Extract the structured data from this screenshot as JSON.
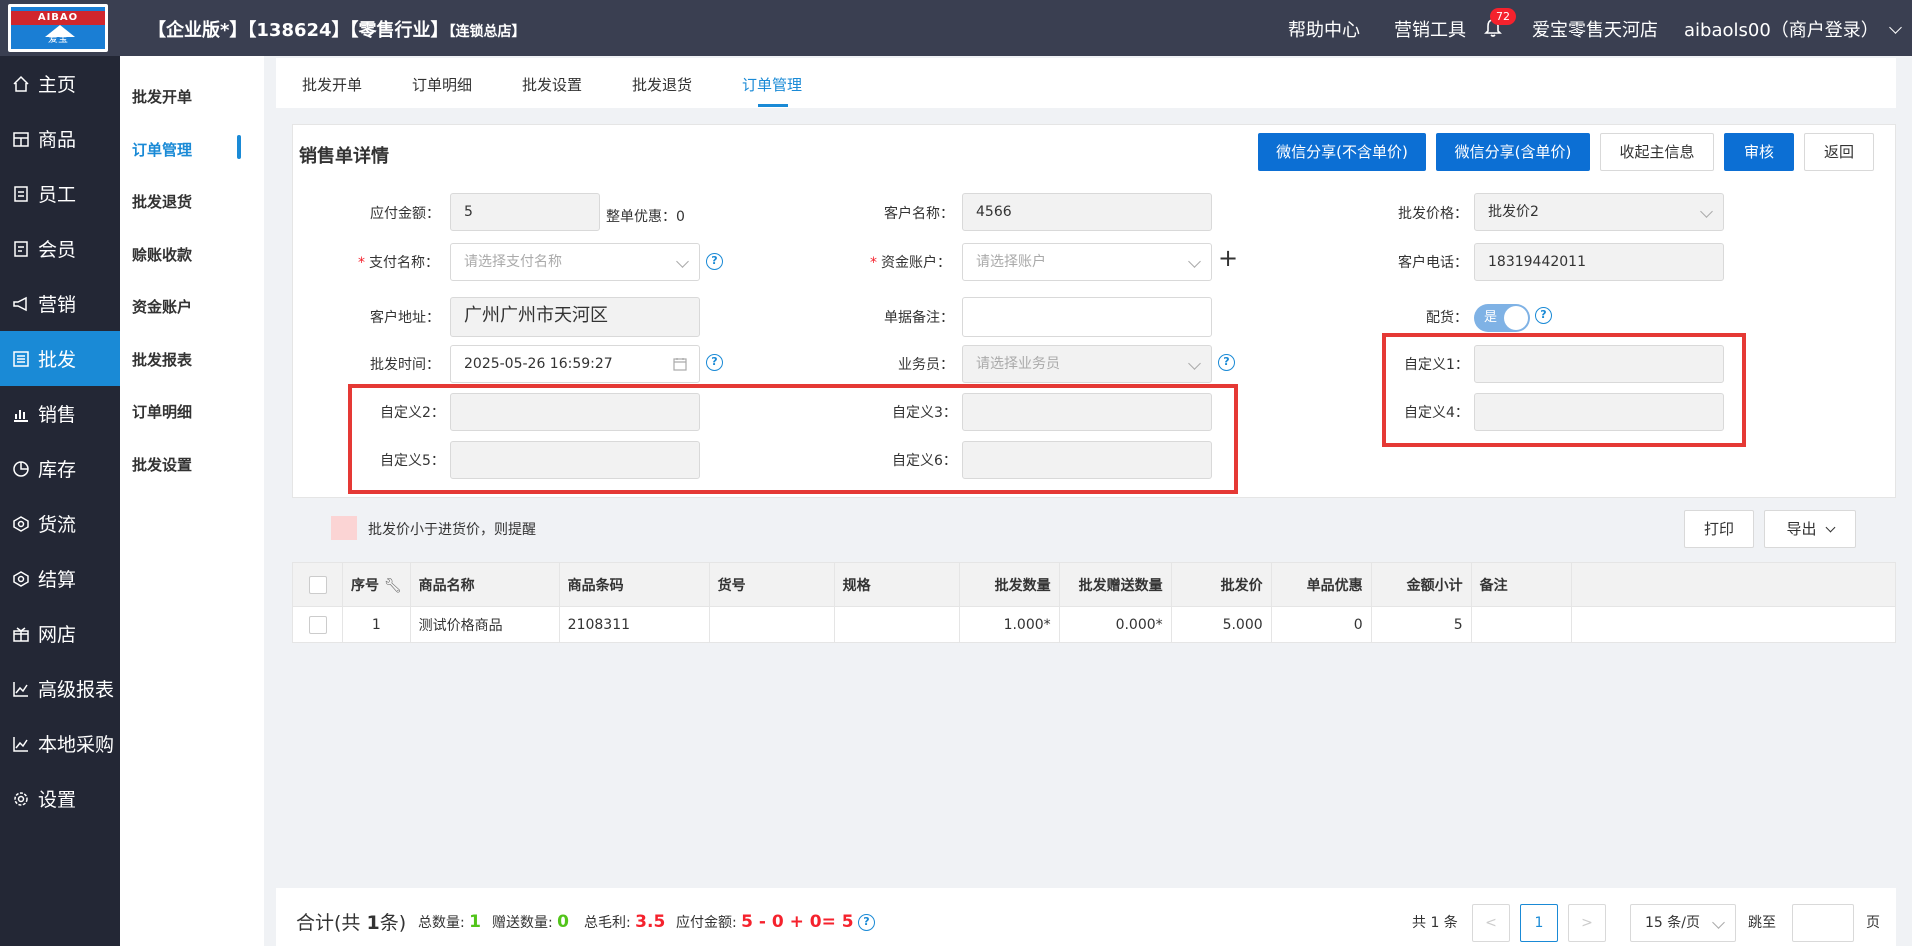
{
  "header": {
    "logo_text_top": "AIBAO",
    "logo_text_bottom": "爱宝",
    "title_main": "【企业版*】【138624】【零售行业】",
    "title_store": "【连锁总店】",
    "help": "帮助中心",
    "marketing_tools": "营销工具",
    "notif_count": "72",
    "store_name": "爱宝零售天河店",
    "user": "aibaols00（商户登录）"
  },
  "sidebar": {
    "items": [
      "主页",
      "商品",
      "员工",
      "会员",
      "营销",
      "批发",
      "销售",
      "库存",
      "货流",
      "结算",
      "网店",
      "高级报表",
      "本地采购",
      "设置"
    ]
  },
  "subnav": {
    "items": [
      "批发开单",
      "订单管理",
      "批发退货",
      "赊账收款",
      "资金账户",
      "批发报表",
      "订单明细",
      "批发设置"
    ]
  },
  "tabs": [
    "批发开单",
    "订单明细",
    "批发设置",
    "批发退货",
    "订单管理"
  ],
  "card": {
    "title": "销售单详情",
    "buttons": {
      "wx_no_price": "微信分享(不含单价)",
      "wx_price": "微信分享(含单价)",
      "collect": "收起主信息",
      "audit": "审核",
      "back": "返回"
    }
  },
  "form": {
    "payable_label": "应付金额：",
    "payable_value": "5",
    "discount_label": "整单优惠：",
    "discount_value": "0",
    "customer_label": "客户名称：",
    "customer_value": "4566",
    "price_label": "批发价格：",
    "price_value": "批发价2",
    "pay_label": "支付名称：",
    "pay_placeholder": "请选择支付名称",
    "account_label": "资金账户：",
    "account_placeholder": "请选择账户",
    "phone_label": "客户电话：",
    "phone_value": "18319442011",
    "address_label": "客户地址：",
    "address_value": "广州广州市天河区",
    "remark_label": "单据备注：",
    "remark_value": "",
    "delivery_label": "配货：",
    "delivery_value": "是",
    "time_label": "批发时间：",
    "time_value": "2025-05-26 16:59:27",
    "sales_label": "业务员：",
    "sales_placeholder": "请选择业务员",
    "c1_label": "自定义1：",
    "c2_label": "自定义2：",
    "c3_label": "自定义3：",
    "c4_label": "自定义4：",
    "c5_label": "自定义5：",
    "c6_label": "自定义6："
  },
  "warning": "批发价小于进货价，则提醒",
  "table_actions": {
    "print": "打印",
    "export": "导出"
  },
  "table": {
    "columns": [
      "序号",
      "商品名称",
      "商品条码",
      "货号",
      "规格",
      "批发数量",
      "批发赠送数量",
      "批发价",
      "单品优惠",
      "金额小计",
      "备注"
    ],
    "rows": [
      [
        "1",
        "测试价格商品",
        "2108311",
        "",
        "",
        "1.000*",
        "0.000*",
        "5.000",
        "0",
        "5",
        ""
      ]
    ]
  },
  "summary": {
    "total_prefix": "合计(共 ",
    "total_count": "1",
    "total_suffix": "条)",
    "qty_label": "总数量:",
    "qty": "1",
    "gift_label": "赠送数量:",
    "gift": "0",
    "profit_label": "总毛利:",
    "profit": "3.5",
    "payable_label": "应付金额:",
    "payable_formula": "5 - 0 + 0= 5"
  },
  "pagination": {
    "total": "共 1 条",
    "page": "1",
    "per_page": "15 条/页",
    "goto": "跳至",
    "page_unit": "页"
  },
  "colors": {
    "primary": "#0c6fd4",
    "sidebar_bg": "#232735",
    "topbar_bg": "#3a3f51",
    "active": "#1a8ad6",
    "highlight_red": "#e53935"
  }
}
